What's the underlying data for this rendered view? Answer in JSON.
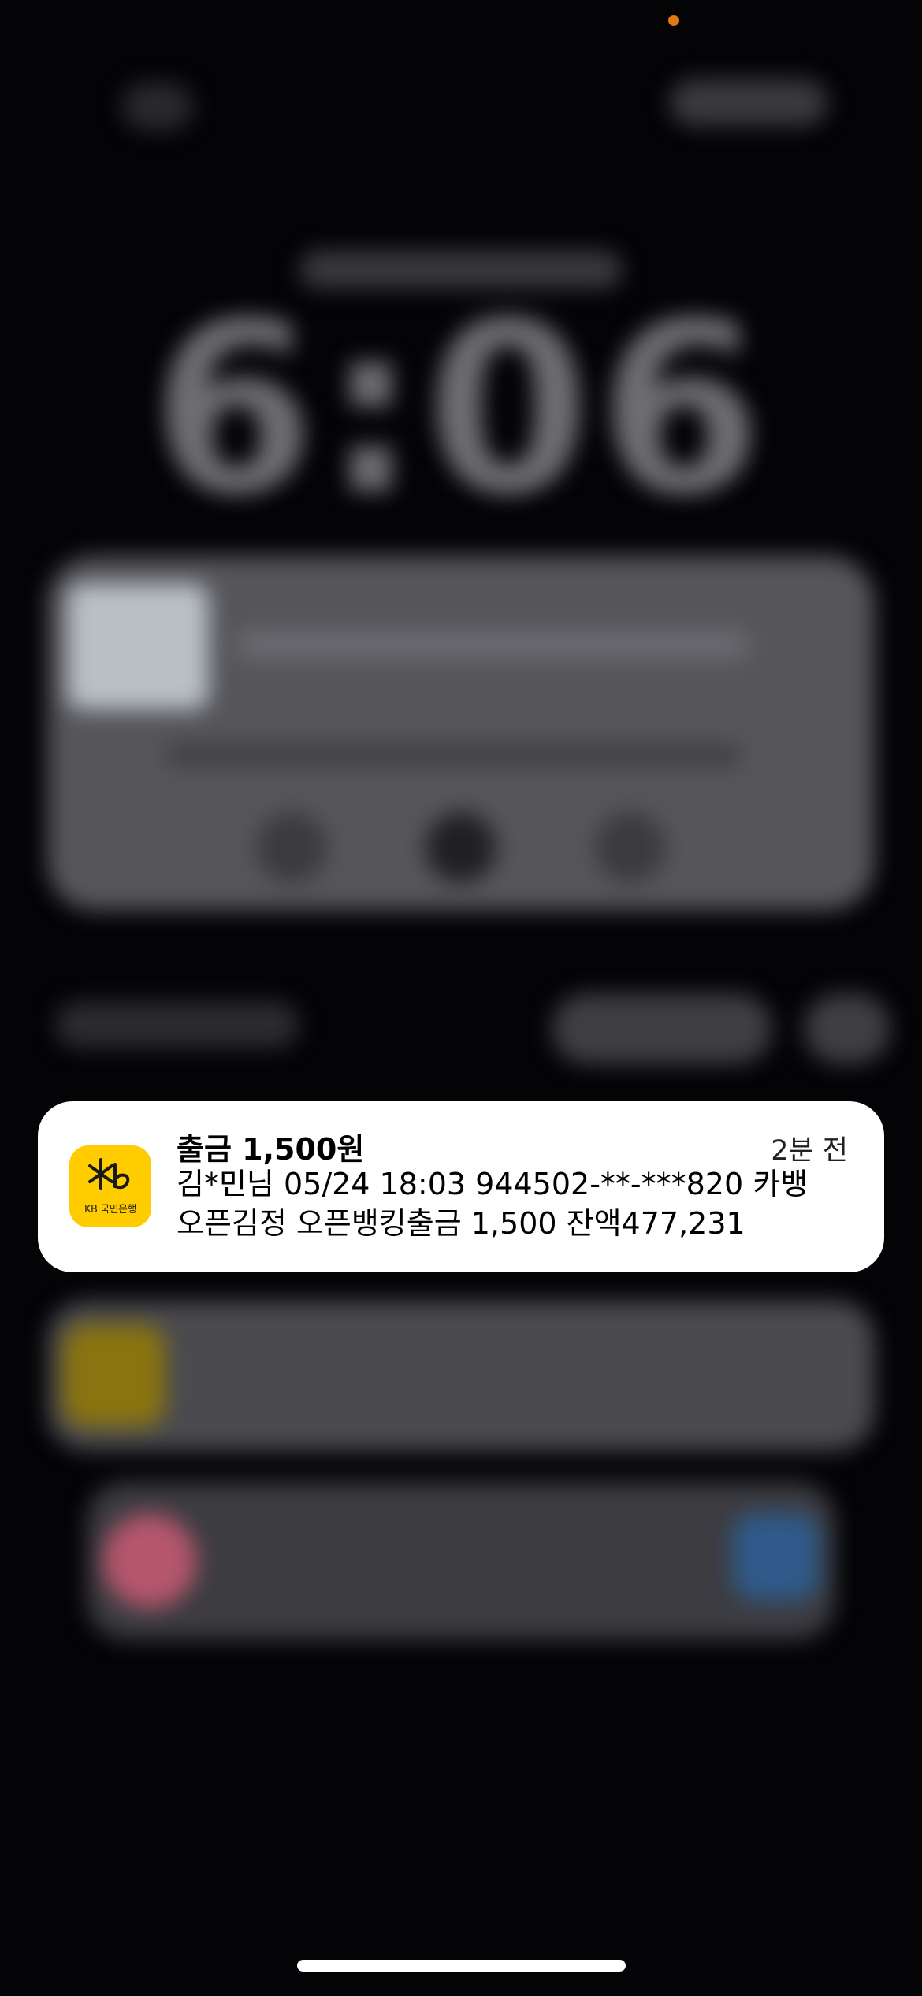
{
  "lockscreen": {
    "clock": "6:06"
  },
  "notification": {
    "app_icon_name": "kb-kookmin-bank-icon",
    "app_icon_text": "KB 국민은행",
    "title": "출금 1,500원",
    "time": "2분 전",
    "body_line1": "김*민님 05/24 18:03 944502-**-***820 카뱅",
    "body_line2": "오픈김정 오픈뱅킹출금 1,500 잔액477,231"
  },
  "colors": {
    "notification_bg": "#ffffff",
    "kb_brand": "#ffcc00",
    "status_dot": "#e07a12"
  }
}
